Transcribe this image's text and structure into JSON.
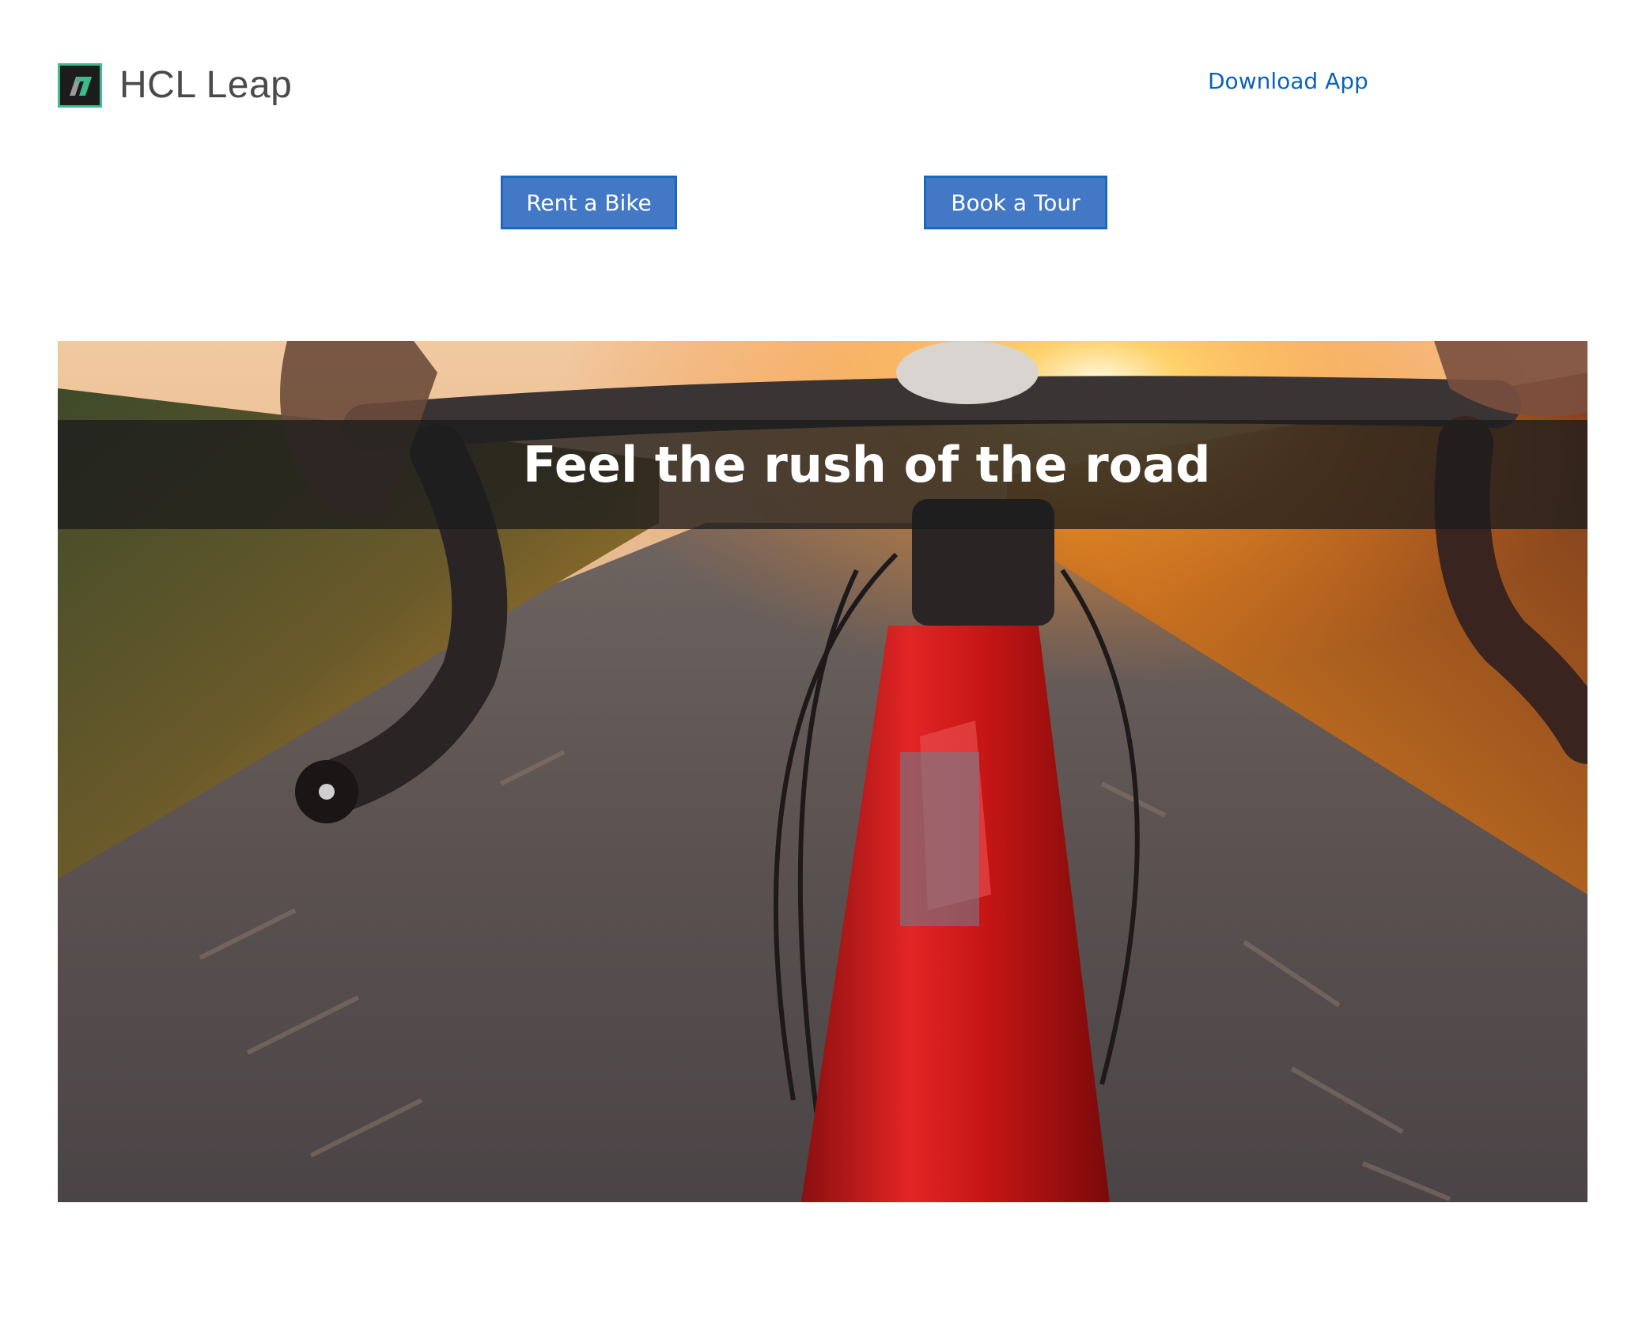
{
  "header": {
    "brand_name": "HCL Leap",
    "download_label": "Download App"
  },
  "actions": {
    "rent_label": "Rent a Bike",
    "tour_label": "Book a Tour"
  },
  "hero": {
    "caption": "Feel the rush of the road",
    "image_subject": "cyclist's view of red road bike handlebars on a sunlit road"
  },
  "colors": {
    "link": "#0b63b6",
    "button_bg": "#4379c4",
    "button_border": "#1769c0",
    "logo_accent": "#3dbb8a",
    "bike_red": "#d61f1f"
  }
}
